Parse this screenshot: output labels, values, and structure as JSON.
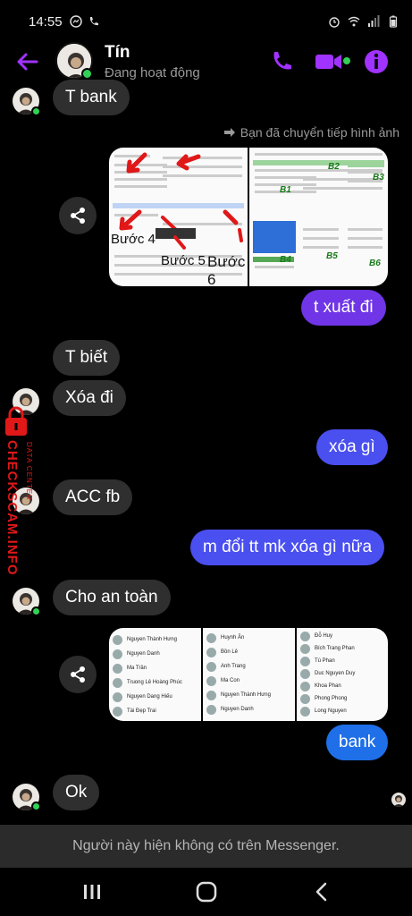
{
  "status_bar": {
    "time": "14:55"
  },
  "header": {
    "name": "Tín",
    "status": "Đang hoạt động"
  },
  "forward_label": "Bạn đã chuyển tiếp hình ảnh",
  "messages": {
    "m1": "T bank",
    "m2": "t xuất đi",
    "m3": "T biết",
    "m4": "Xóa đi",
    "m5": "xóa gì",
    "m6": "ACC fb",
    "m7": "m đổi tt mk xóa gì nữa",
    "m8": "Cho an toàn",
    "m9": "bank",
    "m10": "Ok"
  },
  "attachment1": {
    "labels": [
      "Bước 4",
      "Bước 5",
      "Bước 6",
      "B1",
      "B2",
      "B3",
      "B4",
      "B5",
      "B6"
    ]
  },
  "attachment2": {
    "col1": [
      "Nguyen Thành Hưng",
      "Nguyen Danh",
      "Ma Trần",
      "Truong Lê Hoàng Phúc",
      "Nguyen Dang Hiếu",
      "Tài Đẹp Trai"
    ],
    "col2": [
      "Huynh Ân",
      "Bồn Lê",
      "Anh Trang",
      "Ma Con",
      "Nguyen Thành Hưng",
      "Nguyen Danh"
    ],
    "col3": [
      "Đỗ Huy",
      "Bích Trang Phan",
      "Tú Phan",
      "Duc Nguyen Duy",
      "Khoa Phan",
      "Phong Phong",
      "Long Nguyen"
    ]
  },
  "footer_note": "Người này hiện không có trên Messenger.",
  "watermark": {
    "brand": "CHECKSCAM.INFO",
    "sub": "DATA CENTER"
  },
  "colors": {
    "accent": "#a033ff",
    "bubble_in": "#2f2f2f",
    "bubble_purple": "#6f35e6",
    "bubble_indigo": "#4a4ff0",
    "bubble_blue": "#1f6fe8"
  }
}
